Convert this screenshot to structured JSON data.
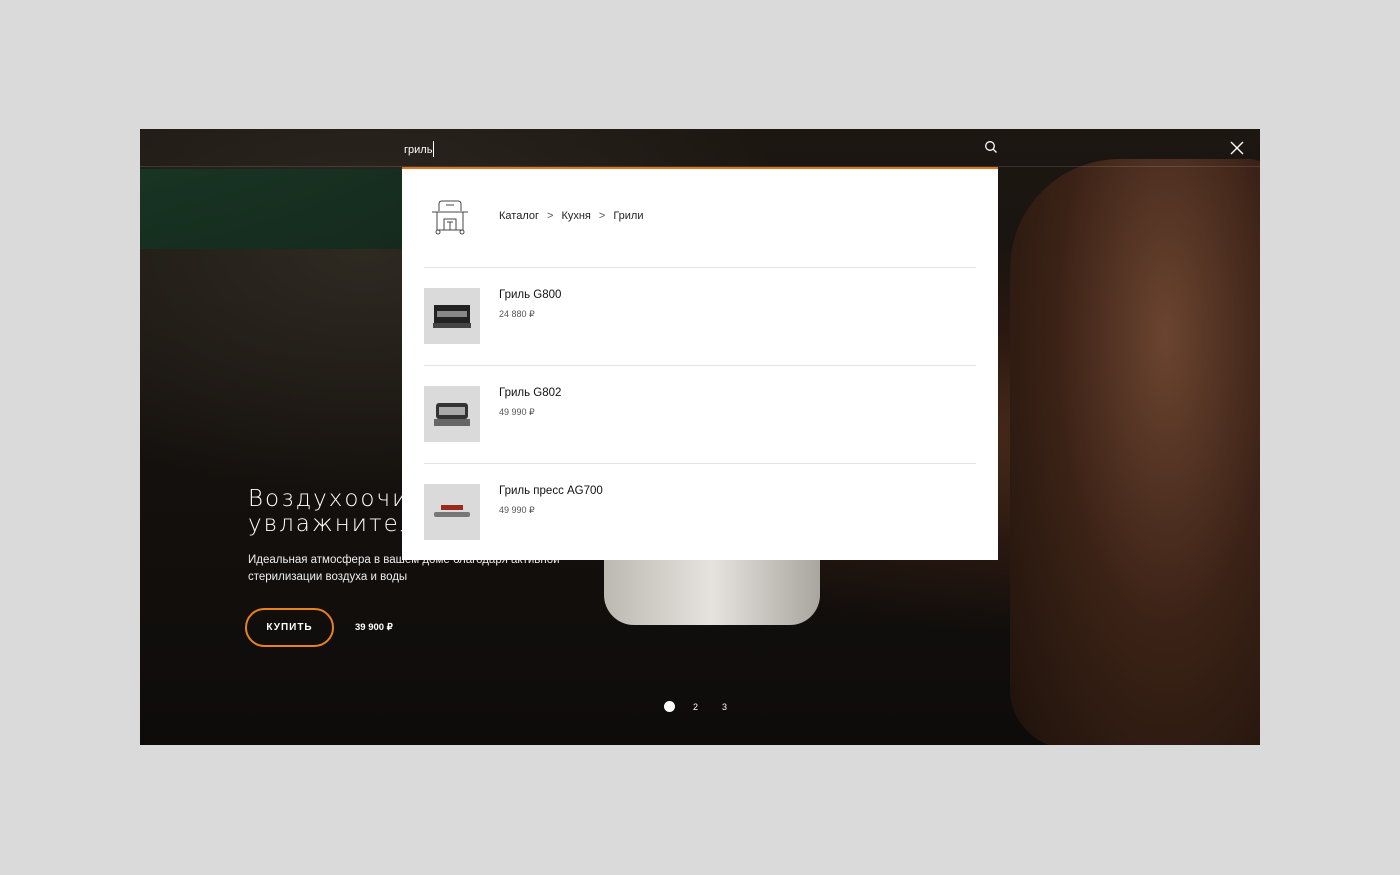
{
  "search": {
    "query": "гриль"
  },
  "dropdown": {
    "breadcrumb": [
      "Каталог",
      "Кухня",
      "Грили"
    ],
    "products": [
      {
        "name": "Гриль G800",
        "price": "24 880 ₽"
      },
      {
        "name": "Гриль G802",
        "price": "49 990 ₽"
      },
      {
        "name": "Гриль пресс AG700",
        "price": "49 990 ₽"
      }
    ]
  },
  "hero": {
    "title_line1": "Воздухоочиститель-",
    "title_line2": "увлажнитель",
    "subtitle_line1": "Идеальная атмосфера в вашем доме благодаря активной",
    "subtitle_line2": "стерилизации воздуха и воды",
    "buy_label": "КУПИТЬ",
    "price": "39 900 ₽"
  },
  "pager": {
    "pages": [
      "1",
      "2",
      "3"
    ],
    "active": 1
  },
  "colors": {
    "accent": "#e8721c"
  }
}
